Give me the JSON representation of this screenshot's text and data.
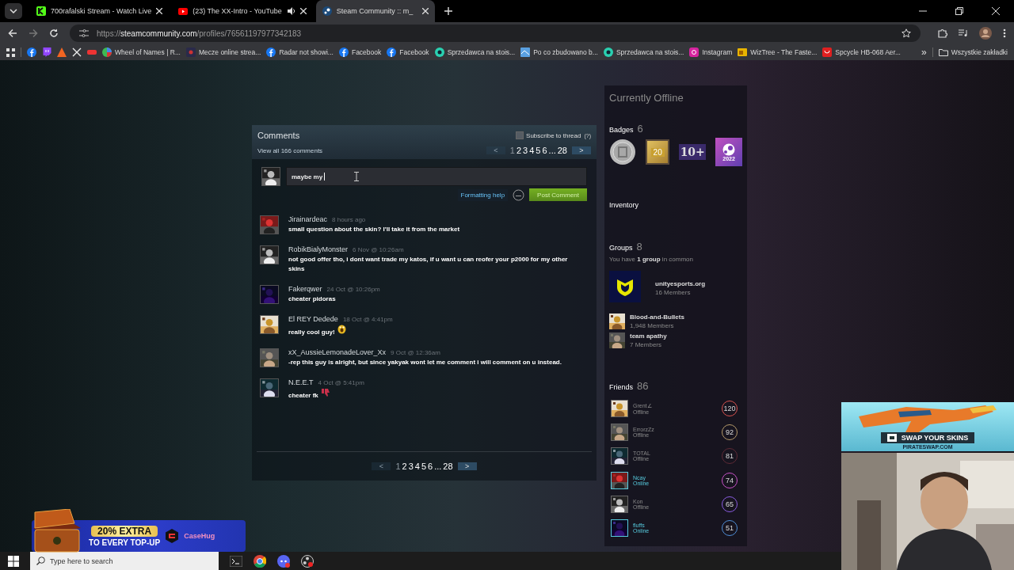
{
  "browser": {
    "tabs": [
      {
        "title": "700rafalski Stream - Watch Live",
        "kind": "green",
        "audio": false,
        "selected": false
      },
      {
        "title": "(23) The XX-Intro - YouTube",
        "kind": "red",
        "audio": true,
        "selected": false
      },
      {
        "title": "Steam Community :: m_",
        "kind": "steam",
        "audio": false,
        "selected": true
      }
    ],
    "address": {
      "scheme": "https://",
      "host": "steamcommunity.com",
      "path": "/profiles/76561197977342183"
    },
    "bookmarks": [
      {
        "kind": "fb"
      },
      {
        "kind": "twitch"
      },
      {
        "kind": "orange"
      },
      {
        "kind": "x"
      },
      {
        "kind": "red"
      },
      {
        "kind": "wheel",
        "label": "Wheel of Names | R..."
      },
      {
        "kind": "dark",
        "label": "Mecze online strea..."
      },
      {
        "kind": "fb",
        "label": "Radar not showi..."
      },
      {
        "kind": "fb",
        "label": "Facebook"
      },
      {
        "kind": "fb",
        "label": "Facebook"
      },
      {
        "kind": "teal",
        "label": "Sprzedawca na stois..."
      },
      {
        "kind": "blue",
        "label": "Po co zbudowano b..."
      },
      {
        "kind": "teal",
        "label": "Sprzedawca na stois..."
      },
      {
        "kind": "insta",
        "label": "Instagram"
      },
      {
        "kind": "yellow",
        "label": "WizTree - The Faste..."
      },
      {
        "kind": "redbox",
        "label": "Spcycle HB-068 Aer..."
      }
    ],
    "more": "»",
    "all_bookmarks": "Wszystkie zakładki"
  },
  "comments": {
    "title": "Comments",
    "subscribe": {
      "label": "Subscribe to thread",
      "checked": false
    },
    "help": "(?)",
    "view_all": "View all 166 comments",
    "top_pager": {
      "prev": "<",
      "prev_disabled": true,
      "pages": [
        {
          "label": "1",
          "selected": true
        },
        {
          "label": "2",
          "selected": false
        },
        {
          "label": "3",
          "selected": false
        },
        {
          "label": "4",
          "selected": false
        },
        {
          "label": "5",
          "selected": false
        },
        {
          "label": "6",
          "selected": false
        },
        {
          "label": "...",
          "selected": false
        },
        {
          "label": "28",
          "selected": false
        }
      ],
      "next": ">"
    },
    "input": {
      "value": "maybe my "
    },
    "formatting_help": "Formatting help",
    "post": "Post Comment",
    "items": [
      {
        "author": "Jirainardeac",
        "time": "8 hours ago",
        "text": "small question about the skin? I'll take it from the market"
      },
      {
        "author": "RobikBialyMonster",
        "time": "6 Nov @ 10:26am",
        "text": "not good offer tho, i dont want trade my katos, if u want u can reofer your p2000 for my other skins"
      },
      {
        "author": "Fakerqwer",
        "time": "24 Oct @ 10:26pm",
        "text": "cheater pidoras"
      },
      {
        "author": "El REY Dedede",
        "time": "18 Oct @ 4:41pm",
        "text": "really cool guy!",
        "kind": "shock"
      },
      {
        "author": "xX_AussieLemonadeLover_Xx",
        "time": "9 Oct @ 12:36am",
        "text": "-rep this guy is alright, but since yakyak wont let me comment i will comment on u instead."
      },
      {
        "author": "N.E.E.T",
        "time": "4 Oct @ 5:41pm",
        "text": "cheater fk",
        "kind": "thumbsdown"
      }
    ],
    "bottom_pager": {
      "prev": "<",
      "prev_disabled": true,
      "pages": [
        {
          "label": "1",
          "selected": true
        },
        {
          "label": "2",
          "selected": false
        },
        {
          "label": "3",
          "selected": false
        },
        {
          "label": "4",
          "selected": false
        },
        {
          "label": "5",
          "selected": false
        },
        {
          "label": "6",
          "selected": false
        },
        {
          "label": "...",
          "selected": false
        },
        {
          "label": "28",
          "selected": false
        }
      ],
      "next": ">"
    }
  },
  "sidebar": {
    "status": "Currently Offline",
    "badges": {
      "title": "Badges",
      "count": "6",
      "items": [
        {
          "kind": "coin"
        },
        {
          "kind": "gold",
          "text": "20"
        },
        {
          "kind": "purple",
          "text": "10+"
        },
        {
          "kind": "steam",
          "text": "2022"
        }
      ]
    },
    "inventory": "Inventory",
    "groups": {
      "title": "Groups",
      "count": "8",
      "common": "You have **1 group** in common",
      "items": [
        {
          "name": "unityesports.org",
          "members": "16 Members",
          "featured": true
        },
        {
          "name": "Blood-and-Bullets",
          "members": "1,948 Members",
          "featured": false
        },
        {
          "name": "team apathy",
          "members": "7 Members",
          "featured": false
        }
      ]
    },
    "friends": {
      "title": "Friends",
      "count": "86",
      "items": [
        {
          "name": "Grent∠",
          "status": "Offline",
          "online": false,
          "level": "120",
          "color": "#d9534f"
        },
        {
          "name": "ErrorzZz",
          "status": "Offline",
          "online": false,
          "level": "92",
          "color": "#b59a6a"
        },
        {
          "name": "TOTAL",
          "status": "Offline",
          "online": false,
          "level": "81",
          "color": "#5e2a36"
        },
        {
          "name": "Ncay",
          "status": "Online",
          "online": true,
          "level": "74",
          "color": "#c852c8"
        },
        {
          "name": "Kon",
          "status": "Offline",
          "online": false,
          "level": "65",
          "color": "#8a5ce0"
        },
        {
          "name": "fluffs",
          "status": "Online",
          "online": true,
          "level": "51",
          "color": "#4f8fd8"
        }
      ]
    }
  },
  "overlays": {
    "casehug": {
      "headline": "20% EXTRA",
      "subline": "TO EVERY TOP-UP",
      "brand": "CaseHug"
    },
    "swap": {
      "text": "SWAP YOUR SKINS",
      "site": "PIRATESWAP.COM"
    }
  },
  "taskbar": {
    "search_placeholder": "Type here to search"
  }
}
